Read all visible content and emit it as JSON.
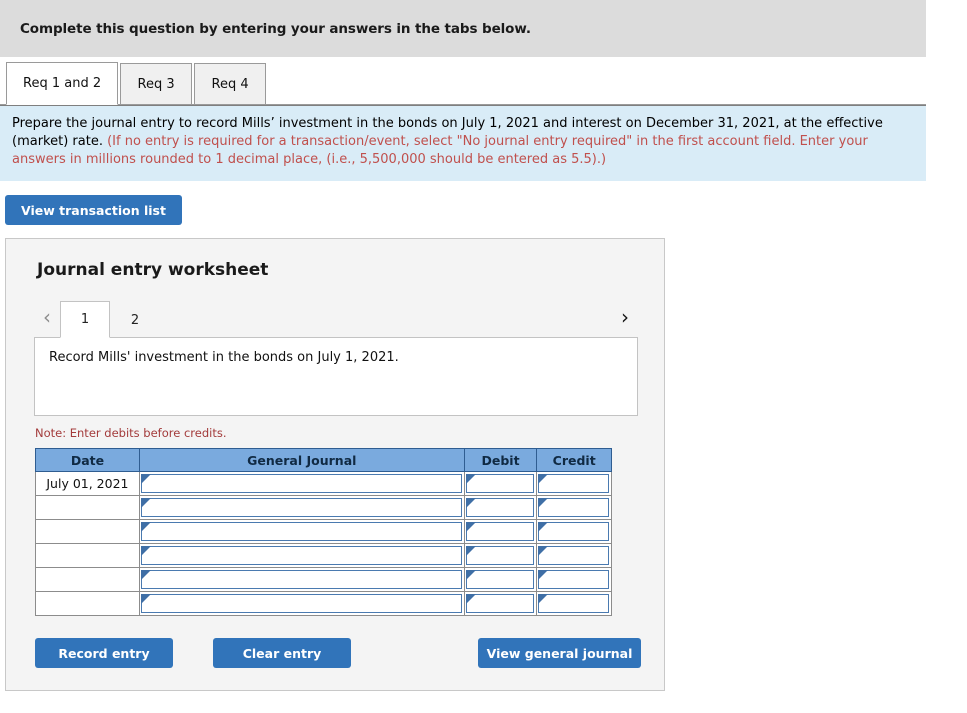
{
  "header": {
    "title": "Complete this question by entering your answers in the tabs below."
  },
  "tabs": [
    {
      "label": "Req 1 and 2",
      "active": true
    },
    {
      "label": "Req 3",
      "active": false
    },
    {
      "label": "Req 4",
      "active": false
    }
  ],
  "requirement": {
    "black_text": "Prepare the journal entry to record Mills’ investment in the bonds on July 1, 2021 and interest on December 31, 2021, at the effective (market) rate.",
    "red_text": "(If no entry is required for a transaction/event, select \"No journal entry required\" in the first account field. Enter your answers in millions rounded to 1 decimal place, (i.e., 5,500,000 should be entered as 5.5).)"
  },
  "transaction_list_button": "View transaction list",
  "worksheet": {
    "title": "Journal entry worksheet",
    "pager": {
      "prev_icon": "chevron-left-icon",
      "next_icon": "chevron-right-icon",
      "pages": [
        {
          "label": "1",
          "active": true
        },
        {
          "label": "2",
          "active": false
        }
      ]
    },
    "description": "Record Mills' investment in the bonds on July 1, 2021.",
    "note": "Note: Enter debits before credits.",
    "table": {
      "columns": [
        "Date",
        "General Journal",
        "Debit",
        "Credit"
      ],
      "rows": [
        {
          "date": "July 01, 2021",
          "general_journal": "",
          "debit": "",
          "credit": ""
        },
        {
          "date": "",
          "general_journal": "",
          "debit": "",
          "credit": ""
        },
        {
          "date": "",
          "general_journal": "",
          "debit": "",
          "credit": ""
        },
        {
          "date": "",
          "general_journal": "",
          "debit": "",
          "credit": ""
        },
        {
          "date": "",
          "general_journal": "",
          "debit": "",
          "credit": ""
        },
        {
          "date": "",
          "general_journal": "",
          "debit": "",
          "credit": ""
        }
      ]
    },
    "actions": {
      "record": "Record entry",
      "clear": "Clear entry",
      "view_journal": "View general journal"
    }
  },
  "colors": {
    "button_blue": "#3174ba",
    "table_header_blue": "#7aaade",
    "banner_blue": "#d9ecf7",
    "top_bar_gray": "#dcdcdc",
    "panel_gray": "#f4f4f4",
    "note_red": "#a33b3b"
  }
}
